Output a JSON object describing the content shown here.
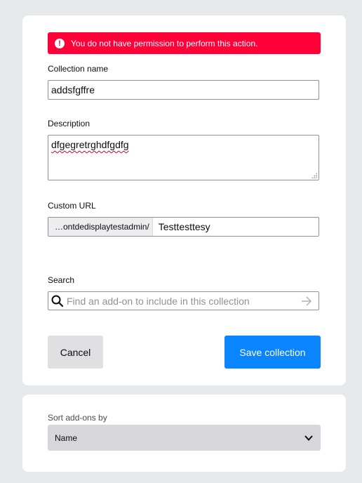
{
  "error": {
    "message": "You do not have permission to perform this action.",
    "icon": "exclamation-icon"
  },
  "form": {
    "collection_name": {
      "label": "Collection name",
      "value": "addsfgffre"
    },
    "description": {
      "label": "Description",
      "value": "dfgegretrghdfgdfg"
    },
    "custom_url": {
      "label": "Custom URL",
      "prefix": "…ontdedisplaytestadmin/",
      "value": "Testtesttesy"
    },
    "search": {
      "label": "Search",
      "placeholder": "Find an add-on to include in this collection"
    }
  },
  "buttons": {
    "cancel": "Cancel",
    "save": "Save collection"
  },
  "sort": {
    "label": "Sort add-ons by",
    "selected": "Name"
  },
  "colors": {
    "error": "#ff0039",
    "primary": "#0a84ff",
    "background": "#e6e9ec"
  }
}
